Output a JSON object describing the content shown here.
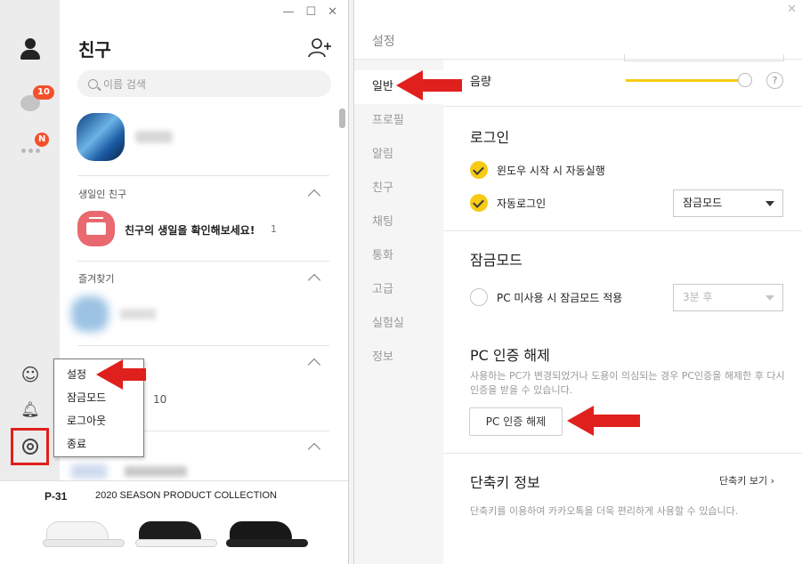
{
  "friends_window": {
    "title": "친구",
    "search_placeholder": "이름 검색",
    "chat_badge": "10",
    "more_badge": "N",
    "sections": {
      "birthday": "생일인 친구",
      "favorites": "즐겨찾기"
    },
    "birthday_text": "친구의 생일을 확인해보세요!",
    "birthday_count": "1",
    "group_count": "10"
  },
  "popup_menu": {
    "items": [
      "설정",
      "잠금모드",
      "로그아웃",
      "종료"
    ]
  },
  "ad": {
    "code": "P-31",
    "title": "2020 SEASON PRODUCT COLLECTION"
  },
  "settings": {
    "title": "설정",
    "nav": [
      "일반",
      "프로필",
      "알림",
      "친구",
      "채팅",
      "통화",
      "고급",
      "실험실",
      "정보"
    ],
    "volume_label": "음량",
    "volume_level": 0.94,
    "help": "?",
    "login": {
      "title": "로그인",
      "auto_start": "윈도우 시작 시 자동실행",
      "auto_login": "자동로그인",
      "auto_login_mode": "잠금모드"
    },
    "lock": {
      "title": "잠금모드",
      "idle_option": "PC 미사용 시 잠금모드 적용",
      "idle_time": "3분 후"
    },
    "pc_auth": {
      "title": "PC 인증 해제",
      "description": "사용하는 PC가 변경되었거나 도용이 의심되는 경우 PC인증을 해제한 후 다시 인증을 받을 수 있습니다.",
      "button": "PC 인증 해제"
    },
    "shortcut": {
      "title": "단축키 정보",
      "link": "단축키 보기",
      "description": "단축키를 이용하여 카카오톡을 더욱 편리하게 사용할 수 있습니다."
    }
  },
  "colors": {
    "accent": "#f7ca14",
    "badge": "#f4502e",
    "annotation": "#e0201c"
  }
}
